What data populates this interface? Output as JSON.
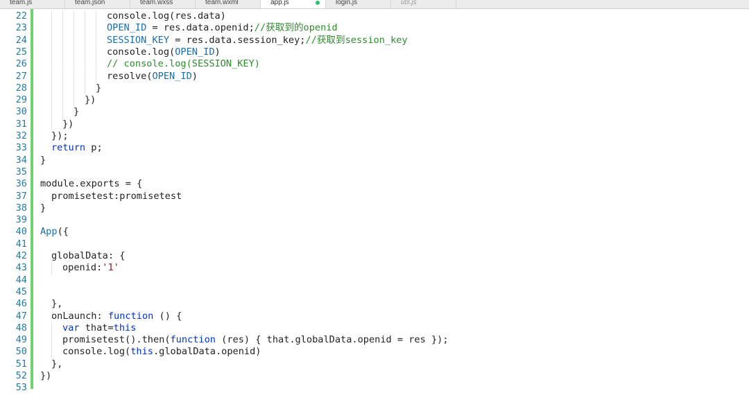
{
  "tabs": [
    {
      "label": "team.js",
      "active": false,
      "preview": false,
      "modified": false
    },
    {
      "label": "team.json",
      "active": false,
      "preview": false,
      "modified": false
    },
    {
      "label": "team.wxss",
      "active": false,
      "preview": false,
      "modified": false
    },
    {
      "label": "team.wxml",
      "active": false,
      "preview": false,
      "modified": false
    },
    {
      "label": "app.js",
      "active": true,
      "preview": false,
      "modified": true
    },
    {
      "label": "login.js",
      "active": false,
      "preview": false,
      "modified": false
    },
    {
      "label": "util.js",
      "active": false,
      "preview": true,
      "modified": false
    }
  ],
  "colors": {
    "gutter_modified": "#6ed56e",
    "line_number": "#2a7a9a",
    "keyword": "#0033cc",
    "identifier": "#1a6ea8",
    "comment": "#2e8b2e",
    "string": "#a31515",
    "modified_dot": "#2fbf71"
  },
  "editor": {
    "lines": [
      {
        "number": "22",
        "indent": 6,
        "tokens": [
          [
            "plain",
            "console.log(res.data)"
          ]
        ]
      },
      {
        "number": "23",
        "indent": 6,
        "tokens": [
          [
            "const",
            "OPEN_ID"
          ],
          [
            "plain",
            " = res.data.openid;"
          ],
          [
            "com",
            "//获取到的openid"
          ]
        ]
      },
      {
        "number": "24",
        "indent": 6,
        "tokens": [
          [
            "const",
            "SESSION_KEY"
          ],
          [
            "plain",
            " = res.data.session_key;"
          ],
          [
            "com",
            "//获取到session_key"
          ]
        ]
      },
      {
        "number": "25",
        "indent": 6,
        "tokens": [
          [
            "plain",
            "console.log("
          ],
          [
            "const",
            "OPEN_ID"
          ],
          [
            "plain",
            ")"
          ]
        ]
      },
      {
        "number": "26",
        "indent": 6,
        "tokens": [
          [
            "com",
            "// console.log(SESSION_KEY)"
          ]
        ]
      },
      {
        "number": "27",
        "indent": 6,
        "tokens": [
          [
            "plain",
            "resolve("
          ],
          [
            "const",
            "OPEN_ID"
          ],
          [
            "plain",
            ")"
          ]
        ]
      },
      {
        "number": "28",
        "indent": 5,
        "tokens": [
          [
            "plain",
            "}"
          ]
        ]
      },
      {
        "number": "29",
        "indent": 4,
        "tokens": [
          [
            "plain",
            "})"
          ]
        ]
      },
      {
        "number": "30",
        "indent": 3,
        "tokens": [
          [
            "plain",
            "}"
          ]
        ]
      },
      {
        "number": "31",
        "indent": 2,
        "tokens": [
          [
            "plain",
            "})"
          ]
        ]
      },
      {
        "number": "32",
        "indent": 1,
        "tokens": [
          [
            "plain",
            "});"
          ]
        ]
      },
      {
        "number": "33",
        "indent": 1,
        "tokens": [
          [
            "kw",
            "return"
          ],
          [
            "plain",
            " p;"
          ]
        ]
      },
      {
        "number": "34",
        "indent": 0,
        "tokens": [
          [
            "plain",
            "}"
          ]
        ]
      },
      {
        "number": "35",
        "indent": 0,
        "tokens": []
      },
      {
        "number": "36",
        "indent": 0,
        "tokens": [
          [
            "plain",
            "module.exports = {"
          ]
        ]
      },
      {
        "number": "37",
        "indent": 1,
        "tokens": [
          [
            "plain",
            "promisetest:promisetest"
          ]
        ]
      },
      {
        "number": "38",
        "indent": 0,
        "tokens": [
          [
            "plain",
            "}"
          ]
        ]
      },
      {
        "number": "39",
        "indent": 0,
        "tokens": []
      },
      {
        "number": "40",
        "indent": 0,
        "tokens": [
          [
            "fn",
            "App"
          ],
          [
            "plain",
            "({"
          ]
        ]
      },
      {
        "number": "41",
        "indent": 0,
        "tokens": []
      },
      {
        "number": "42",
        "indent": 1,
        "tokens": [
          [
            "plain",
            "globalData: {"
          ]
        ]
      },
      {
        "number": "43",
        "indent": 2,
        "tokens": [
          [
            "plain",
            "openid:"
          ],
          [
            "str",
            "'1'"
          ]
        ]
      },
      {
        "number": "44",
        "indent": 0,
        "tokens": []
      },
      {
        "number": "45",
        "indent": 0,
        "tokens": []
      },
      {
        "number": "46",
        "indent": 1,
        "tokens": [
          [
            "plain",
            "},"
          ]
        ]
      },
      {
        "number": "47",
        "indent": 1,
        "tokens": [
          [
            "plain",
            "onLaunch: "
          ],
          [
            "kw",
            "function"
          ],
          [
            "plain",
            " () {"
          ]
        ]
      },
      {
        "number": "48",
        "indent": 2,
        "tokens": [
          [
            "kw",
            "var"
          ],
          [
            "plain",
            " that="
          ],
          [
            "kw",
            "this"
          ]
        ]
      },
      {
        "number": "49",
        "indent": 2,
        "tokens": [
          [
            "plain",
            "promisetest().then("
          ],
          [
            "kw",
            "function"
          ],
          [
            "plain",
            " (res) { that.globalData.openid = res });"
          ]
        ]
      },
      {
        "number": "50",
        "indent": 2,
        "tokens": [
          [
            "plain",
            "console.log("
          ],
          [
            "kw",
            "this"
          ],
          [
            "plain",
            ".globalData.openid)"
          ]
        ]
      },
      {
        "number": "51",
        "indent": 1,
        "tokens": [
          [
            "plain",
            "},"
          ]
        ]
      },
      {
        "number": "52",
        "indent": 0,
        "tokens": [
          [
            "plain",
            "})"
          ]
        ]
      },
      {
        "number": "53",
        "indent": 0,
        "tokens": []
      }
    ]
  }
}
